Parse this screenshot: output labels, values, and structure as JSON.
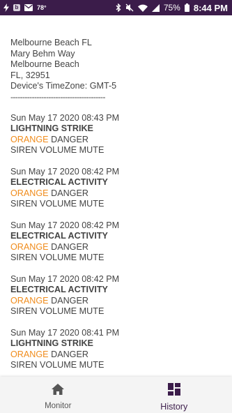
{
  "status_bar": {
    "temperature": "78°",
    "battery": "75%",
    "time": "8:44 PM",
    "icons": [
      "flash-icon",
      "b-app-icon",
      "mail-icon",
      "bluetooth-icon",
      "mute-icon",
      "wifi-icon",
      "signal-icon",
      "battery-icon"
    ],
    "background_color": "#3b1c4a"
  },
  "location": {
    "lines": [
      "Melbourne Beach FL",
      "Mary Behm Way",
      "Melbourne Beach",
      "FL, 32951",
      "Device's TimeZone: GMT-5"
    ],
    "divider": "----------------------------------------"
  },
  "events": [
    {
      "time": "Sun May 17 2020 08:43 PM",
      "type": "LIGHTNING STRIKE",
      "level": "ORANGE",
      "level_suffix": " DANGER",
      "siren": "SIREN VOLUME MUTE"
    },
    {
      "time": "Sun May 17 2020 08:42 PM",
      "type": "ELECTRICAL ACTIVITY",
      "level": "ORANGE",
      "level_suffix": " DANGER",
      "siren": "SIREN VOLUME MUTE"
    },
    {
      "time": "Sun May 17 2020 08:42 PM",
      "type": "ELECTRICAL ACTIVITY",
      "level": "ORANGE",
      "level_suffix": " DANGER",
      "siren": "SIREN VOLUME MUTE"
    },
    {
      "time": "Sun May 17 2020 08:42 PM",
      "type": "ELECTRICAL ACTIVITY",
      "level": "ORANGE",
      "level_suffix": " DANGER",
      "siren": "SIREN VOLUME MUTE"
    },
    {
      "time": "Sun May 17 2020 08:41 PM",
      "type": "LIGHTNING STRIKE",
      "level": "ORANGE",
      "level_suffix": " DANGER",
      "siren": "SIREN VOLUME MUTE"
    }
  ],
  "colors": {
    "danger_orange": "#f08c1c",
    "text_gray": "#444444",
    "accent_purple": "#3b1c4a"
  },
  "bottom_nav": {
    "items": [
      {
        "label": "Monitor",
        "icon": "home-icon",
        "active": false
      },
      {
        "label": "History",
        "icon": "dashboard-icon",
        "active": true
      }
    ]
  }
}
